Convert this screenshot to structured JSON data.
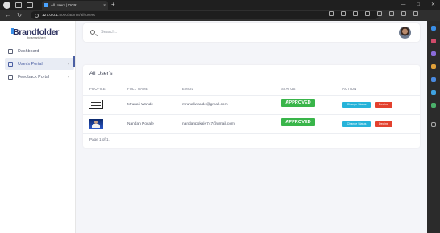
{
  "browser": {
    "tab_title": "All Users | OCR",
    "tab_close": "×",
    "new_tab": "+",
    "url_host": "127.0.0.1",
    "url_path": ":8000/admin/all-users",
    "window_controls": [
      "—",
      "□",
      "✕"
    ]
  },
  "sidebar": {
    "brand": "Brandfolder",
    "brand_sub": "by smartsheet",
    "items": [
      {
        "label": "Dashboard",
        "icon": "home-icon",
        "chevron": ""
      },
      {
        "label": "User's Portal",
        "icon": "users-icon",
        "chevron": "›"
      },
      {
        "label": "Feedback Portal",
        "icon": "feedback-icon",
        "chevron": "›"
      }
    ]
  },
  "search": {
    "placeholder": "Search..."
  },
  "users_card": {
    "title": "All User's",
    "columns": [
      "PROFILE",
      "FULL NAME",
      "EMAIL",
      "STATUS",
      "ACTION"
    ],
    "rows": [
      {
        "name": "Mrunali Wande",
        "email": "mrunaliwande@gmail.com",
        "status": "APPROVED",
        "profile_icon": "document-thumbnail"
      },
      {
        "name": "Nandan Pokale",
        "email": "nandanpokale747@gmail.com",
        "status": "APPROVED",
        "profile_icon": "photo-thumbnail"
      }
    ],
    "change_label": "Change Status",
    "decline_label": "Decline",
    "pager": "Page 1 of 1."
  },
  "colors": {
    "approved": "#39b54a",
    "change_status": "#26b3d9",
    "decline": "#e3412e",
    "accent": "#4b5fa3"
  }
}
